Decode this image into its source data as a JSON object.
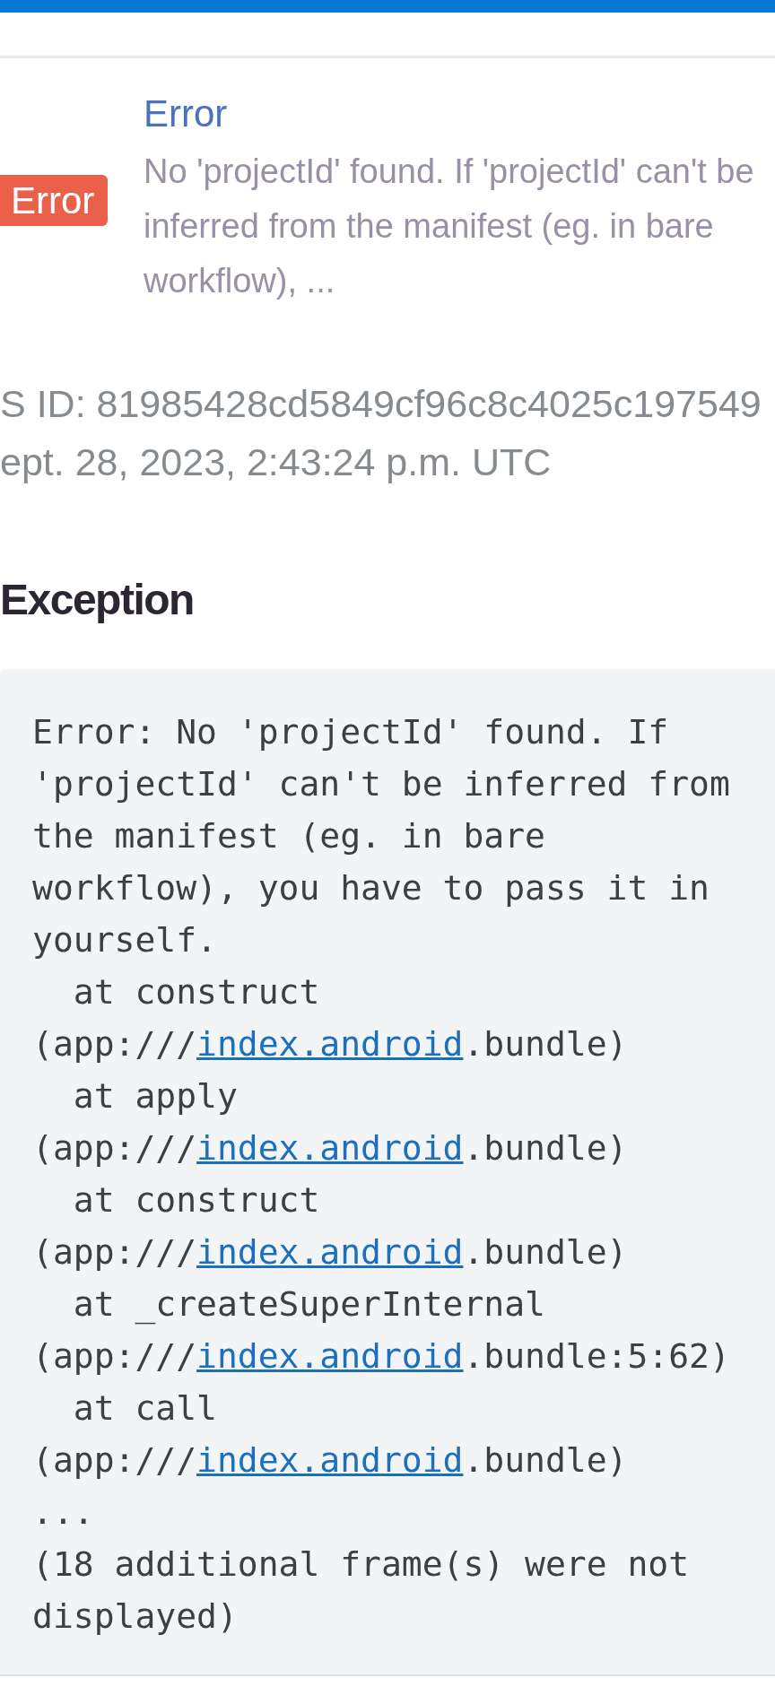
{
  "issue": {
    "badge": "Error",
    "title": "Error",
    "message": "No 'projectId' found. If 'projectId' can't be inferred from the manifest (eg. in bare workflow), ..."
  },
  "event": {
    "id": "S ID: 81985428cd5849cf96c8c4025c197549",
    "date": "ept. 28, 2023, 2:43:24 p.m. UTC"
  },
  "exception": {
    "heading": "Exception",
    "message": "Error: No 'projectId' found. If 'projectId' can't be inferred from the manifest (eg. in bare workflow), you have to pass it in yourself.",
    "frames": [
      {
        "call": "at construct",
        "before": "(app:///",
        "link": "index.android",
        "after": ".bundle)"
      },
      {
        "call": "at apply",
        "before": "(app:///",
        "link": "index.android",
        "after": ".bundle)"
      },
      {
        "call": "at construct",
        "before": "(app:///",
        "link": "index.android",
        "after": ".bundle)"
      },
      {
        "call": "at _createSuperInternal",
        "before": "(app:///",
        "link": "index.android",
        "after": ".bundle:5:62)"
      },
      {
        "call": "at call",
        "before": "(app:///",
        "link": "index.android",
        "after": ".bundle)"
      }
    ],
    "ellipsis": "...",
    "note": "(18 additional frame(s) were not displayed)"
  }
}
